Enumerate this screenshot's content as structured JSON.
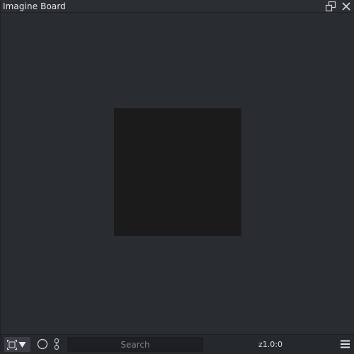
{
  "window": {
    "title": "Imagine Board"
  },
  "title_actions": {
    "restore_icon": "window-restore-icon",
    "close_icon": "close-icon"
  },
  "board": {
    "color": "#1b1b1c"
  },
  "bottombar": {
    "fit_icon": "fit-frame-icon",
    "dropdown_icon": "triangle-down-icon",
    "circle_icon": "circle-icon",
    "link_icon": "link-icon",
    "search": {
      "placeholder": "Search",
      "value": ""
    },
    "zoom_text": "z1.0:0",
    "menu_icon": "hamburger-menu-icon"
  },
  "colors": {
    "background": "#282b30",
    "titlebar": "#2b2e33",
    "bottombar": "#25282c",
    "text": "#e6e8ea"
  }
}
